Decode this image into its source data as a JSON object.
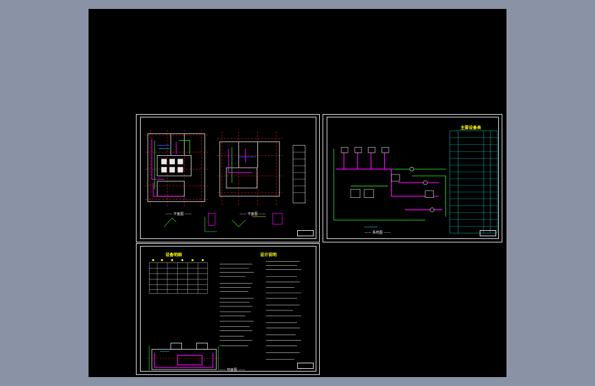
{
  "app": {
    "background_color": "#8a93a6",
    "viewport_color": "#000000"
  },
  "palette": {
    "wall": "#e8e8e8",
    "grid": "#ff2020",
    "pipe_magenta": "#ff00ff",
    "pipe_green": "#22dd22",
    "pipe_cyan": "#00ffff",
    "pipe_blue": "#4050ff",
    "annotation_yellow": "#ffff00"
  },
  "sheets": {
    "plan": {
      "caption_left": "—— 平面图 ——",
      "caption_right": "—— 平面图 ——"
    },
    "system": {
      "table_title": "主要设备表",
      "caption": "—— 系统图 ——"
    },
    "notes": {
      "table_title": "设备明细",
      "notes_title": "设计说明",
      "caption": "—— 剖面图 ——"
    }
  }
}
